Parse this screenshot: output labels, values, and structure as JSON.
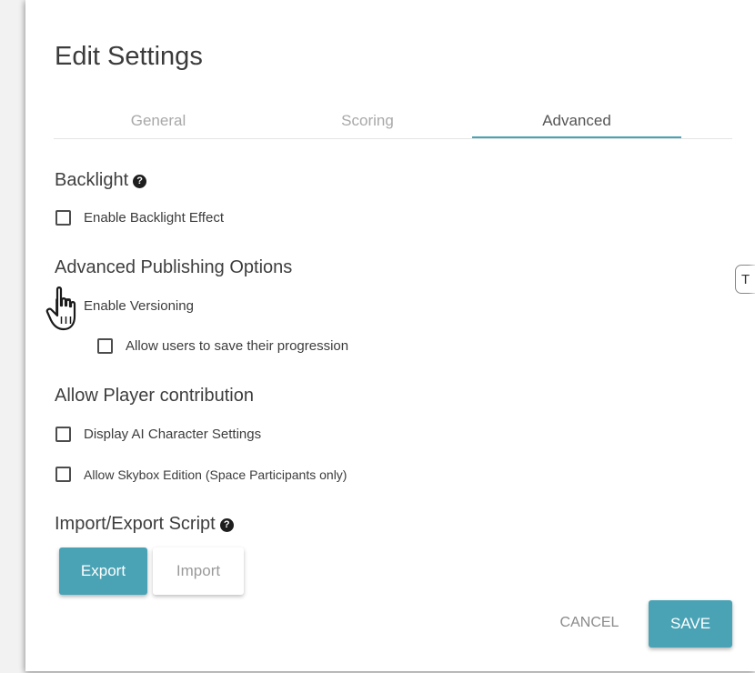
{
  "dialog": {
    "title": "Edit Settings",
    "tabs": [
      {
        "label": "General",
        "active": false
      },
      {
        "label": "Scoring",
        "active": false
      },
      {
        "label": "Advanced",
        "active": true
      }
    ]
  },
  "sections": {
    "backlight": {
      "title": "Backlight",
      "enable_backlight": {
        "label": "Enable Backlight Effect",
        "checked": false
      }
    },
    "publishing": {
      "title": "Advanced Publishing Options",
      "enable_versioning": {
        "label": "Enable Versioning",
        "checked": false
      },
      "save_progression": {
        "label": "Allow users to save their progression",
        "checked": false
      }
    },
    "player_contribution": {
      "title": "Allow Player contribution",
      "ai_character": {
        "label": "Display AI Character Settings",
        "checked": false
      },
      "skybox": {
        "label": "Allow Skybox Edition (Space Participants only)",
        "checked": false
      }
    },
    "script": {
      "title": "Import/Export Script",
      "export_label": "Export",
      "import_label": "Import"
    }
  },
  "footer": {
    "cancel_label": "CANCEL",
    "save_label": "SAVE"
  },
  "side_tab": {
    "label": "T"
  },
  "icons": {
    "help": "question-circle-icon",
    "cursor": "hand-pointer-cursor"
  },
  "colors": {
    "accent": "#4aa3b5",
    "tab_inactive": "#a8a8a8",
    "text": "#3a3a3a"
  }
}
